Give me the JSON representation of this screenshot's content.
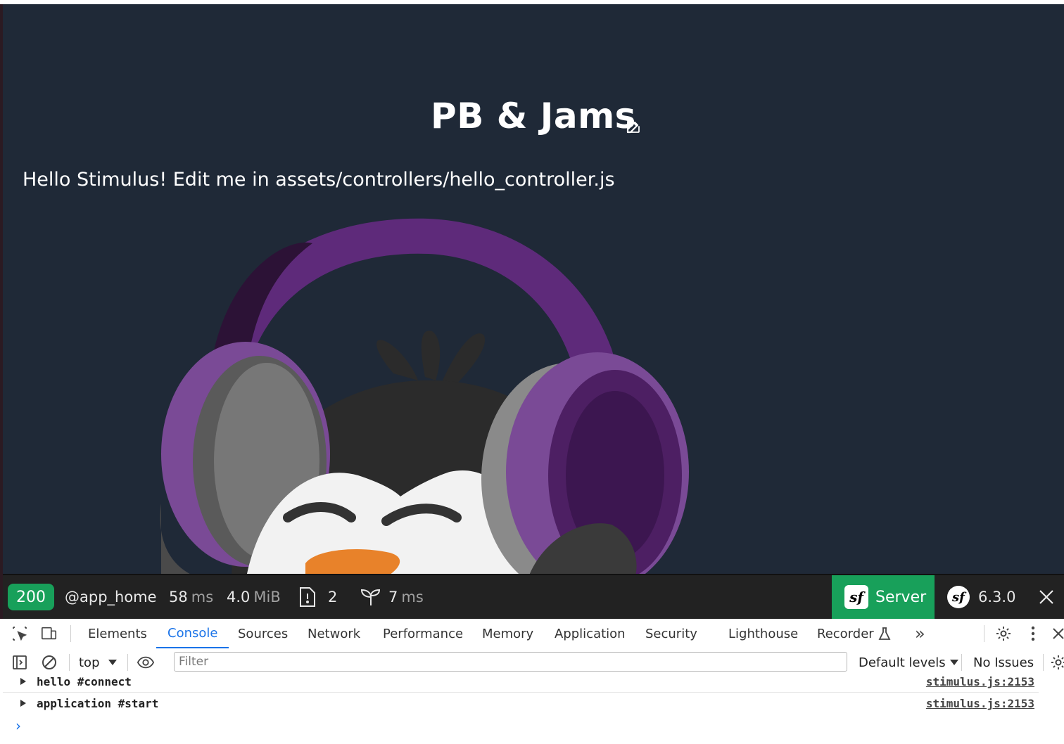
{
  "page": {
    "title": "PB & Jams",
    "hello_text": "Hello Stimulus! Edit me in assets/controllers/hello_controller.js"
  },
  "profiler_toolbar": {
    "status_code": "200",
    "route": "@app_home",
    "time_value": "58",
    "time_unit": "ms",
    "memory_value": "4.0",
    "memory_unit": "MiB",
    "logs_count": "2",
    "twig_value": "7",
    "twig_unit": "ms",
    "server_label": "Server",
    "version": "6.3.0",
    "symfony_glyph": "sf"
  },
  "devtools": {
    "tabs": [
      "Elements",
      "Console",
      "Sources",
      "Network",
      "Performance",
      "Memory",
      "Application",
      "Security",
      "Lighthouse",
      "Recorder"
    ],
    "active_tab": "Console",
    "context": "top",
    "filter_placeholder": "Filter",
    "levels": "Default levels",
    "issues": "No Issues",
    "more_tabs": "»",
    "logs": [
      {
        "message": "hello #connect",
        "source": "stimulus.js:2153"
      },
      {
        "message": "application #start",
        "source": "stimulus.js:2153"
      }
    ],
    "prompt": "›"
  },
  "colors": {
    "page_bg": "#1f2937",
    "toolbar_bg": "#222222",
    "success_green": "#18a05a",
    "active_tab_blue": "#1a73e8",
    "headphone_purple": "#5e2a7a"
  },
  "icons": [
    "edit-icon",
    "file-icon",
    "sprout-icon",
    "close-icon",
    "inspect-icon",
    "device-icon",
    "flask-icon",
    "gear-icon",
    "kebab-icon",
    "sidebar-icon",
    "clear-icon",
    "eye-icon"
  ]
}
